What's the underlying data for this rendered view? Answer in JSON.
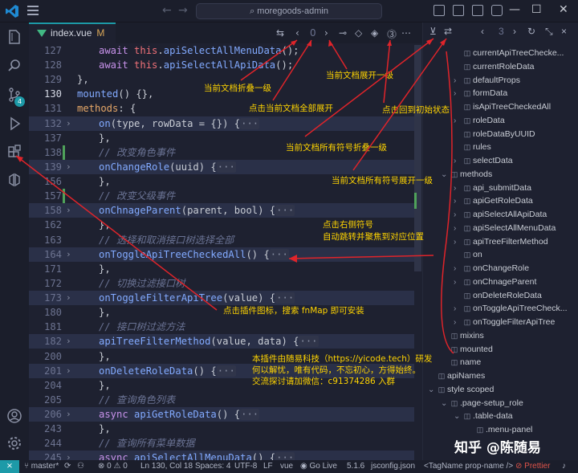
{
  "titlebar": {
    "search_text": "moregoods-admin"
  },
  "tab": {
    "filename": "index.vue",
    "modified_marker": "M",
    "close_glyph": "×"
  },
  "editor_toolbar": {
    "counter": "0"
  },
  "panel_toolbar": {
    "counter": "3"
  },
  "code_lines": [
    {
      "ln": "127",
      "text": "await this.apiSelectAllMenuData();"
    },
    {
      "ln": "128",
      "text": "await this.apiSelectAllApiData();"
    },
    {
      "ln": "129",
      "text": "},"
    },
    {
      "ln": "130",
      "text": "mounted() {},"
    },
    {
      "ln": "131",
      "text": "methods: {"
    },
    {
      "ln": "132",
      "text": "on(type, rowData = {}) {···"
    },
    {
      "ln": "137",
      "text": "},"
    },
    {
      "ln": "138",
      "text": "// 改变角色事件"
    },
    {
      "ln": "139",
      "text": "onChangeRole(uuid) {···"
    },
    {
      "ln": "156",
      "text": "},"
    },
    {
      "ln": "157",
      "text": "// 改变父级事件"
    },
    {
      "ln": "158",
      "text": "onChnageParent(parent, bool) {···"
    },
    {
      "ln": "162",
      "text": "},"
    },
    {
      "ln": "163",
      "text": "// 选择和取消接口树选择全部"
    },
    {
      "ln": "164",
      "text": "onToggleApiTreeCheckedAll() {···"
    },
    {
      "ln": "171",
      "text": "},"
    },
    {
      "ln": "172",
      "text": "// 切换过滤接口树"
    },
    {
      "ln": "173",
      "text": "onToggleFilterApiTree(value) {···"
    },
    {
      "ln": "180",
      "text": "},"
    },
    {
      "ln": "181",
      "text": "// 接口树过滤方法"
    },
    {
      "ln": "182",
      "text": "apiTreeFilterMethod(value, data) {···"
    },
    {
      "ln": "200",
      "text": "},"
    },
    {
      "ln": "201",
      "text": "onDeleteRoleData() {···"
    },
    {
      "ln": "204",
      "text": "},"
    },
    {
      "ln": "205",
      "text": "// 查询角色列表"
    },
    {
      "ln": "206",
      "text": "async apiGetRoleData() {···"
    },
    {
      "ln": "243",
      "text": "},"
    },
    {
      "ln": "244",
      "text": "// 查询所有菜单数据"
    },
    {
      "ln": "245",
      "text": "async apiSelectAllMenuData() {···"
    }
  ],
  "outline": [
    "currentApiTreeChecke...",
    "currentRoleData",
    "defaultProps",
    "formData",
    "isApiTreeCheckedAll",
    "roleData",
    "roleDataByUUID",
    "rules",
    "selectData",
    "methods",
    "api_submitData",
    "apiGetRoleData",
    "apiSelectAllApiData",
    "apiSelectAllMenuData",
    "apiTreeFilterMethod",
    "on",
    "onChangeRole",
    "onChnageParent",
    "onDeleteRoleData",
    "onToggleApiTreeCheck...",
    "onToggleFilterApiTree",
    "mixins",
    "mounted",
    "name",
    "apiNames",
    "style scoped",
    ".page-setup_role",
    ".table-data",
    ".menu-panel"
  ],
  "annotations": {
    "fold_one": "当前文档折叠一级",
    "expand_one": "当前文档展开一级",
    "expand_all": "点击当前文档全部展开",
    "reset": "点击回到初始状态",
    "fold_symbols": "当前文档所有符号折叠一级",
    "expand_symbols": "当前文档所有符号展开一级",
    "click_right_line1": "点击右侧符号",
    "click_right_line2": "自动跳转并聚焦到对应位置",
    "install": "点击插件图标，搜索 fnMap 即可安装",
    "credit_line1": "本插件由随易科技（https://yicode.tech）研发",
    "credit_line2": "何以解忧，唯有代码，不忘初心，方得始终。",
    "credit_line3": "交流探讨请加微信：c91374286 入群"
  },
  "watermark": "知乎 @陈随易",
  "statusbar": {
    "branch": "master*",
    "problems": "⊗ 0 ⚠ 0",
    "position": "Ln 130, Col 18",
    "spaces": "Spaces: 4",
    "encoding": "UTF-8",
    "eol": "LF",
    "language": "vue",
    "golive": "Go Live",
    "version": "5.1.6",
    "jsconfig": "jsconfig.json",
    "tagname": "<TagName prop-name />",
    "prettier": "Prettier",
    "badge": "4"
  },
  "colors": {
    "accent": "#1d9aa8",
    "annotation": "#ffd400",
    "arrow": "#e0242a"
  }
}
